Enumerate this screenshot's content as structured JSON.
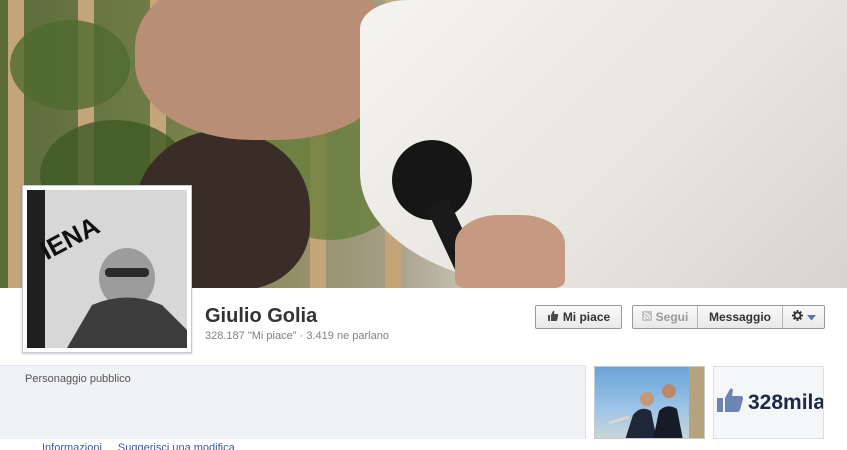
{
  "page": {
    "name": "Giulio Golia",
    "stats": "328.187 \"Mi piace\" · 3.419 ne parlano",
    "category": "Personaggio pubblico"
  },
  "profile_picture": {
    "text": "IENA"
  },
  "actions": {
    "like_label": "Mi piace",
    "follow_label": "Segui",
    "message_label": "Messaggio"
  },
  "links": {
    "info": "Informazioni",
    "suggest_edit": "Suggerisci una modifica"
  },
  "sidebar_thumbs": {
    "likes_value": "328mila"
  },
  "icons": {
    "like": "thumbs-up-icon",
    "follow": "rss-icon",
    "settings": "gear-icon",
    "dropdown": "chevron-down-icon"
  },
  "colors": {
    "link": "#3b5998",
    "name": "#333333",
    "subtle_text": "#808080"
  }
}
